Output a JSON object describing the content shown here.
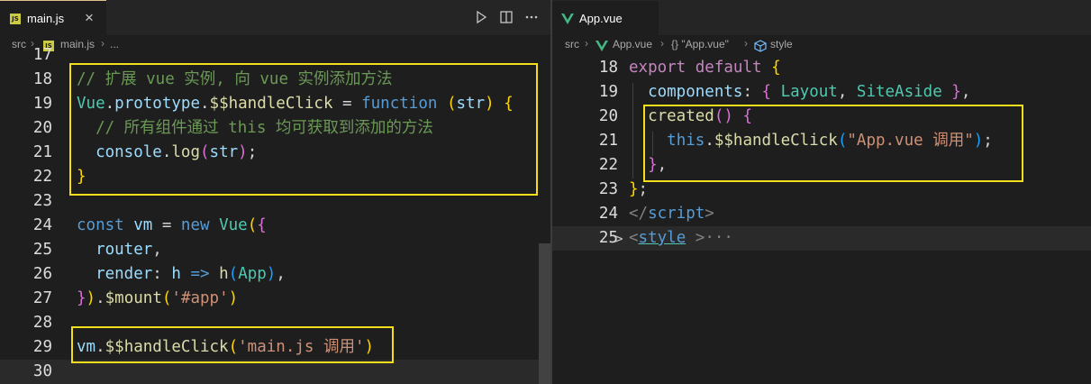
{
  "left": {
    "tab": {
      "label": "main.js",
      "icon": "js-file-icon",
      "close": "×"
    },
    "breadcrumb": {
      "folder": "src",
      "file": "main.js",
      "more": "..."
    }
  },
  "right": {
    "tab": {
      "label": "App.vue",
      "icon": "vue-file-icon"
    },
    "breadcrumb": {
      "folder": "src",
      "file": "App.vue",
      "symbol": "{} \"App.vue\"",
      "section": "style"
    }
  },
  "left_lines": [
    {
      "n": "17",
      "t": []
    },
    {
      "n": "18",
      "t": [
        {
          "c": "cmt",
          "v": "// 扩展 vue 实例, 向 vue 实例添加方法"
        }
      ]
    },
    {
      "n": "19",
      "t": [
        {
          "c": "cls",
          "v": "Vue"
        },
        {
          "c": "w",
          "v": "."
        },
        {
          "c": "var",
          "v": "prototype"
        },
        {
          "c": "w",
          "v": "."
        },
        {
          "c": "fn",
          "v": "$$handleClick"
        },
        {
          "c": "w",
          "v": " = "
        },
        {
          "c": "kw",
          "v": "function"
        },
        {
          "c": "w",
          "v": " "
        },
        {
          "c": "p1",
          "v": "("
        },
        {
          "c": "var",
          "v": "str"
        },
        {
          "c": "p1",
          "v": ")"
        },
        {
          "c": "w",
          "v": " "
        },
        {
          "c": "p1",
          "v": "{"
        }
      ]
    },
    {
      "n": "20",
      "t": [
        {
          "c": "w",
          "v": "  "
        },
        {
          "c": "cmt",
          "v": "// 所有组件通过 this 均可获取到添加的方法"
        }
      ]
    },
    {
      "n": "21",
      "t": [
        {
          "c": "w",
          "v": "  "
        },
        {
          "c": "var",
          "v": "console"
        },
        {
          "c": "w",
          "v": "."
        },
        {
          "c": "fn",
          "v": "log"
        },
        {
          "c": "p2",
          "v": "("
        },
        {
          "c": "var",
          "v": "str"
        },
        {
          "c": "p2",
          "v": ")"
        },
        {
          "c": "w",
          "v": ";"
        }
      ]
    },
    {
      "n": "22",
      "t": [
        {
          "c": "p1",
          "v": "}"
        }
      ]
    },
    {
      "n": "23",
      "t": []
    },
    {
      "n": "24",
      "t": [
        {
          "c": "kw",
          "v": "const"
        },
        {
          "c": "w",
          "v": " "
        },
        {
          "c": "var",
          "v": "vm"
        },
        {
          "c": "w",
          "v": " = "
        },
        {
          "c": "kw",
          "v": "new"
        },
        {
          "c": "w",
          "v": " "
        },
        {
          "c": "cls",
          "v": "Vue"
        },
        {
          "c": "p1",
          "v": "("
        },
        {
          "c": "p2",
          "v": "{"
        }
      ]
    },
    {
      "n": "25",
      "t": [
        {
          "c": "w",
          "v": "  "
        },
        {
          "c": "var",
          "v": "router"
        },
        {
          "c": "w",
          "v": ","
        }
      ]
    },
    {
      "n": "26",
      "t": [
        {
          "c": "w",
          "v": "  "
        },
        {
          "c": "var",
          "v": "render"
        },
        {
          "c": "w",
          "v": ": "
        },
        {
          "c": "var",
          "v": "h"
        },
        {
          "c": "w",
          "v": " "
        },
        {
          "c": "kw",
          "v": "=>"
        },
        {
          "c": "w",
          "v": " "
        },
        {
          "c": "fn",
          "v": "h"
        },
        {
          "c": "p3",
          "v": "("
        },
        {
          "c": "cls",
          "v": "App"
        },
        {
          "c": "p3",
          "v": ")"
        },
        {
          "c": "w",
          "v": ","
        }
      ]
    },
    {
      "n": "27",
      "t": [
        {
          "c": "p2",
          "v": "}"
        },
        {
          "c": "p1",
          "v": ")"
        },
        {
          "c": "w",
          "v": "."
        },
        {
          "c": "fn",
          "v": "$mount"
        },
        {
          "c": "p1",
          "v": "("
        },
        {
          "c": "str",
          "v": "'#app'"
        },
        {
          "c": "p1",
          "v": ")"
        }
      ]
    },
    {
      "n": "28",
      "t": []
    },
    {
      "n": "29",
      "t": [
        {
          "c": "var",
          "v": "vm"
        },
        {
          "c": "w",
          "v": "."
        },
        {
          "c": "fn",
          "v": "$$handleClick"
        },
        {
          "c": "p1",
          "v": "("
        },
        {
          "c": "str",
          "v": "'main.js 调用'"
        },
        {
          "c": "p1",
          "v": ")"
        }
      ]
    },
    {
      "n": "30",
      "t": []
    }
  ],
  "right_lines": [
    {
      "n": "18",
      "t": [
        {
          "c": "ctrl",
          "v": "export"
        },
        {
          "c": "w",
          "v": " "
        },
        {
          "c": "ctrl",
          "v": "default"
        },
        {
          "c": "w",
          "v": " "
        },
        {
          "c": "p1",
          "v": "{"
        }
      ]
    },
    {
      "n": "19",
      "t": [
        {
          "c": "w",
          "v": "  "
        },
        {
          "c": "var",
          "v": "components"
        },
        {
          "c": "w",
          "v": ": "
        },
        {
          "c": "p2",
          "v": "{"
        },
        {
          "c": "w",
          "v": " "
        },
        {
          "c": "cls",
          "v": "Layout"
        },
        {
          "c": "w",
          "v": ", "
        },
        {
          "c": "cls",
          "v": "SiteAside"
        },
        {
          "c": "w",
          "v": " "
        },
        {
          "c": "p2",
          "v": "}"
        },
        {
          "c": "w",
          "v": ","
        }
      ]
    },
    {
      "n": "20",
      "t": [
        {
          "c": "w",
          "v": "  "
        },
        {
          "c": "fn",
          "v": "created"
        },
        {
          "c": "p2",
          "v": "()"
        },
        {
          "c": "w",
          "v": " "
        },
        {
          "c": "p2",
          "v": "{"
        }
      ]
    },
    {
      "n": "21",
      "t": [
        {
          "c": "w",
          "v": "    "
        },
        {
          "c": "kw",
          "v": "this"
        },
        {
          "c": "w",
          "v": "."
        },
        {
          "c": "fn",
          "v": "$$handleClick"
        },
        {
          "c": "p3",
          "v": "("
        },
        {
          "c": "str",
          "v": "\"App.vue 调用\""
        },
        {
          "c": "p3",
          "v": ")"
        },
        {
          "c": "w",
          "v": ";"
        }
      ]
    },
    {
      "n": "22",
      "t": [
        {
          "c": "w",
          "v": "  "
        },
        {
          "c": "p2",
          "v": "}"
        },
        {
          "c": "w",
          "v": ","
        }
      ]
    },
    {
      "n": "23",
      "t": [
        {
          "c": "p1",
          "v": "}"
        },
        {
          "c": "w",
          "v": ";"
        }
      ]
    },
    {
      "n": "24",
      "t": [
        {
          "c": "tag",
          "v": "</"
        },
        {
          "c": "tagn",
          "v": "script"
        },
        {
          "c": "tag",
          "v": ">"
        }
      ]
    },
    {
      "n": "25",
      "t": [
        {
          "c": "tag",
          "v": "<"
        },
        {
          "c": "tagn ul",
          "v": "style"
        },
        {
          "c": "w",
          "v": " "
        },
        {
          "c": "tag",
          "v": ">···"
        }
      ]
    }
  ],
  "right_fold_marker": ">"
}
